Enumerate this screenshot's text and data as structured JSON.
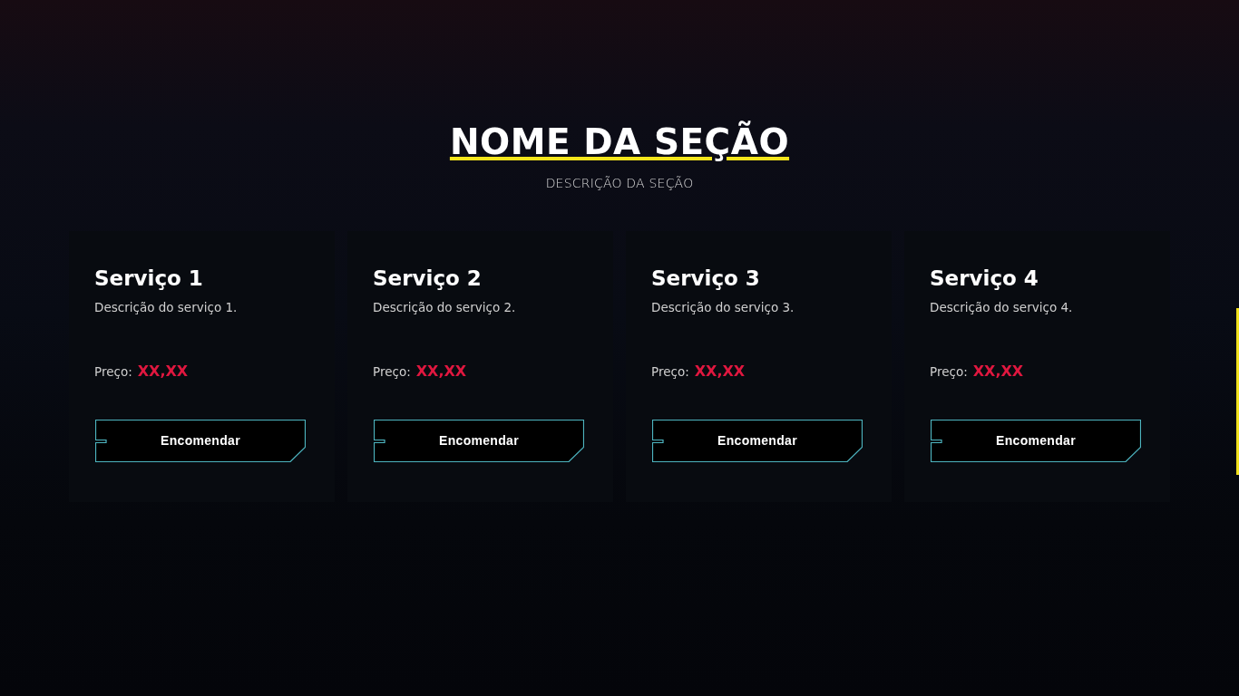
{
  "section": {
    "title": "NOME DA SEÇÃO",
    "description": "DESCRIÇÃO DA SEÇÃO"
  },
  "services": [
    {
      "title": "Serviço 1",
      "description": "Descrição do serviço 1.",
      "price_label": "Preço:",
      "price": "XX,XX",
      "button": "Encomendar"
    },
    {
      "title": "Serviço 2",
      "description": "Descrição do serviço 2.",
      "price_label": "Preço:",
      "price": "XX,XX",
      "button": "Encomendar"
    },
    {
      "title": "Serviço 3",
      "description": "Descrição do serviço 3.",
      "price_label": "Preço:",
      "price": "XX,XX",
      "button": "Encomendar"
    },
    {
      "title": "Serviço 4",
      "description": "Descrição do serviço 4.",
      "price_label": "Preço:",
      "price": "XX,XX",
      "button": "Encomendar"
    }
  ]
}
